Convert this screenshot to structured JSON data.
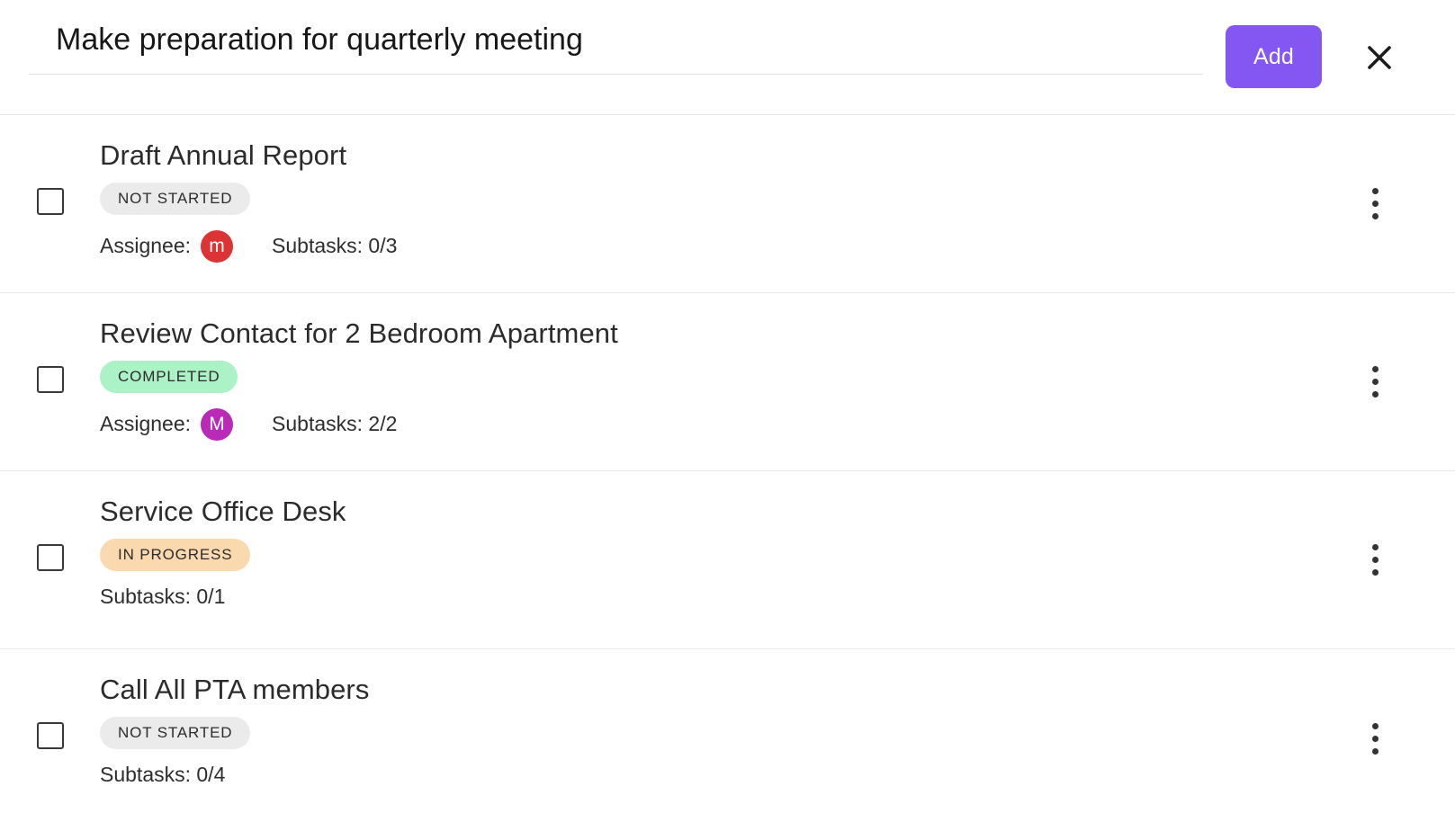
{
  "header": {
    "title_value": "Make preparation for quarterly meeting",
    "title_placeholder": "Task name",
    "add_label": "Add",
    "close_icon": "close-icon",
    "accent_color": "#8456f2"
  },
  "labels": {
    "assignee": "Assignee:",
    "subtasks_prefix": "Subtasks:"
  },
  "tasks": [
    {
      "title": "Draft Annual Report",
      "status": "NOT STARTED",
      "status_key": "not-started",
      "status_color": "#ebebeb",
      "assignee_label": "Assignee:",
      "assignee_initial": "m",
      "assignee_color": "#db3434",
      "has_assignee": true,
      "subtasks": "Subtasks: 0/3",
      "subtasks_done": 0,
      "subtasks_total": 3,
      "checked": false,
      "menu_icon": "more-vertical-icon"
    },
    {
      "title": "Review Contact for 2 Bedroom Apartment",
      "status": "COMPLETED",
      "status_key": "completed",
      "status_color": "#abf2c6",
      "assignee_label": "Assignee:",
      "assignee_initial": "M",
      "assignee_color": "#b92bb7",
      "has_assignee": true,
      "subtasks": "Subtasks: 2/2",
      "subtasks_done": 2,
      "subtasks_total": 2,
      "checked": false,
      "menu_icon": "more-vertical-icon"
    },
    {
      "title": "Service Office Desk",
      "status": "IN PROGRESS",
      "status_key": "in-progress",
      "status_color": "#fbd9ae",
      "assignee_label": "",
      "assignee_initial": "",
      "assignee_color": "",
      "has_assignee": false,
      "subtasks": "Subtasks: 0/1",
      "subtasks_done": 0,
      "subtasks_total": 1,
      "checked": false,
      "menu_icon": "more-vertical-icon"
    },
    {
      "title": "Call All PTA members",
      "status": "NOT STARTED",
      "status_key": "not-started",
      "status_color": "#ebebeb",
      "assignee_label": "",
      "assignee_initial": "",
      "assignee_color": "",
      "has_assignee": false,
      "subtasks": "Subtasks: 0/4",
      "subtasks_done": 0,
      "subtasks_total": 4,
      "checked": false,
      "menu_icon": "more-vertical-icon"
    }
  ]
}
